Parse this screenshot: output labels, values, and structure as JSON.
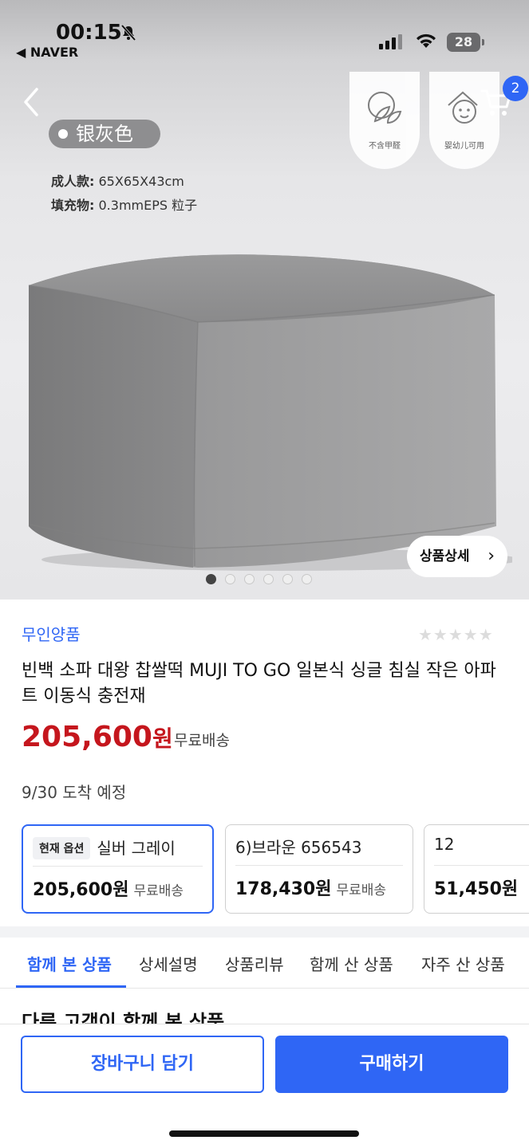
{
  "status_bar": {
    "time": "00:15",
    "back_app": "◀ NAVER",
    "battery": "28"
  },
  "header": {
    "cart_count": "2",
    "badges": [
      "不含甲醛",
      "婴幼儿可用"
    ]
  },
  "hero": {
    "color_label": "银灰色",
    "spec_1_label": "成人款:",
    "spec_1_value": "65X65X43cm",
    "spec_2_label": "填充物:",
    "spec_2_value": "0.3mmEPS 粒子",
    "detail_button": "상품상세",
    "slide_count": 6,
    "active_slide": 1
  },
  "product": {
    "brand": "무인양품",
    "rating_stars": "★★★★★",
    "title": "빈백 소파 대왕 찹쌀떡 MUJI TO GO 일본식 싱글 침실 작은 아파트 이동식 충전재",
    "price": "205,600",
    "won": "원",
    "shipping": "무료배송",
    "arrival": "9/30 도착 예정"
  },
  "options": [
    {
      "current_tag": "현재 옵션",
      "name": "실버 그레이",
      "price": "205,600원",
      "shipping": "무료배송"
    },
    {
      "name": "6)브라운 656543",
      "price": "178,430원",
      "shipping": "무료배송"
    },
    {
      "name": "12",
      "price": "51,450원",
      "shipping": ""
    }
  ],
  "tabs": [
    "함께 본 상품",
    "상세설명",
    "상품리뷰",
    "함께 산 상품",
    "자주 산 상품"
  ],
  "section_peek": "다른 고객이 함께 본 상품",
  "bottom": {
    "cart_button": "장바구니 담기",
    "buy_button": "구매하기"
  },
  "colors": {
    "accent": "#2f66f5",
    "price": "#c5161d"
  }
}
